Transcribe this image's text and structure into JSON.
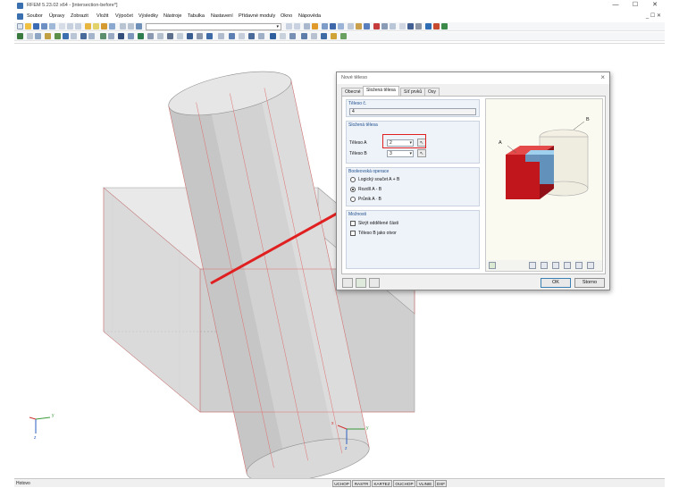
{
  "window": {
    "title": "RFEM 5.23.02 x64 - [intersection-before*]",
    "controls": [
      "—",
      "☐",
      "✕"
    ],
    "mdi_controls": "_ ☐ ✕"
  },
  "menu": [
    "Soubor",
    "Úpravy",
    "Zobrazit",
    "Vložit",
    "Výpočet",
    "Výsledky",
    "Nástroje",
    "Tabulka",
    "Nastavení",
    "Přídavné moduly",
    "Okno",
    "Nápověda"
  ],
  "toolbar": {
    "combo1_value": "",
    "combo2_value": ""
  },
  "statusbar": {
    "left_text": "Hotovo",
    "buttons": [
      "UCHOP",
      "RASTR",
      "KARTEZ",
      "OUCHOP",
      "VLINIE",
      "DXF"
    ]
  },
  "axes": {
    "x_label": "x",
    "y_label": "y",
    "z_label": "z"
  },
  "dialog": {
    "title": "Nové těleso",
    "tabs": [
      "Obecné",
      "Složená tělesa",
      "Síť prvků",
      "Osy"
    ],
    "active_tab": "Složená tělesa",
    "body_no": {
      "heading": "Těleso č.",
      "value": "4"
    },
    "composite": {
      "heading": "Složená tělesa",
      "body_a_label": "Těleso A",
      "body_a_value": "2",
      "body_b_label": "Těleso B",
      "body_b_value": "3"
    },
    "boolean": {
      "heading": "Booleovská operace",
      "options": [
        "Logický součet A + B",
        "Rozdíl A - B",
        "Průnik A ∙ B"
      ],
      "selected_index": 1
    },
    "options": {
      "heading": "Možnosti",
      "items": [
        "Skrýt oddělené části",
        "Těleso B jako otvor"
      ],
      "checked": [
        false,
        false
      ]
    },
    "preview_labels": {
      "a": "A",
      "b": "B"
    },
    "ok_label": "OK",
    "cancel_label": "Storno"
  },
  "colors": {
    "highlight": "#e02020",
    "accent": "#1f4e8c",
    "body_red": "#c0161c",
    "body_blue": "#5aa9d8"
  }
}
